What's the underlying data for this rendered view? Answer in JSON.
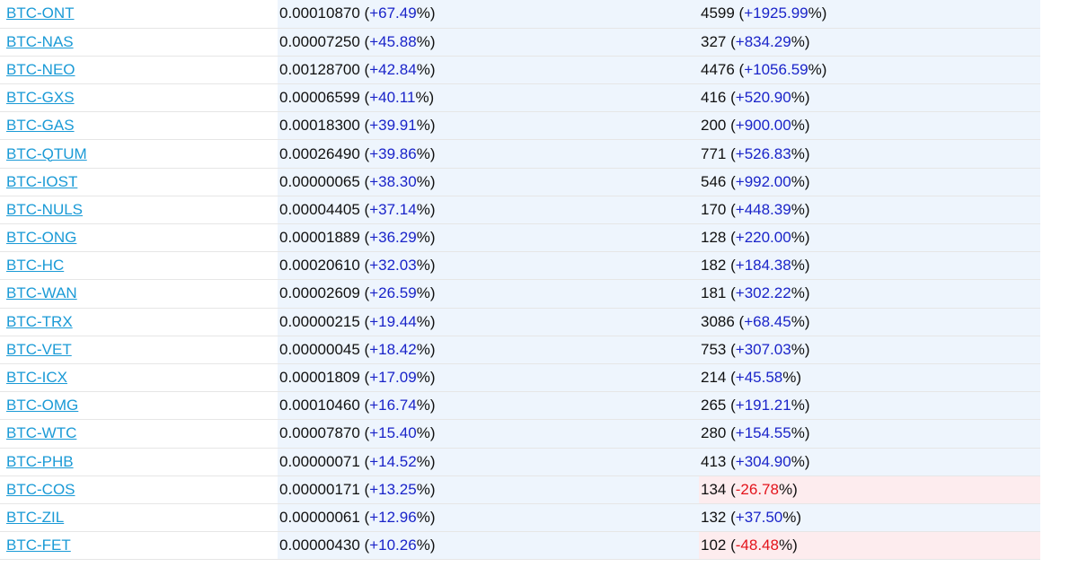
{
  "colors": {
    "link": "#1a9ad6",
    "positive": "#1a24c9",
    "negative": "#e3131b",
    "cell_bg": "#eef5fd",
    "cell_bg_negative": "#fdecee"
  },
  "rows": [
    {
      "pair": "BTC-ONT",
      "price": "0.00010870",
      "price_change": "+67.49",
      "volume": "4599",
      "volume_change": "+1925.99",
      "volume_negative": false
    },
    {
      "pair": "BTC-NAS",
      "price": "0.00007250",
      "price_change": "+45.88",
      "volume": "327",
      "volume_change": "+834.29",
      "volume_negative": false
    },
    {
      "pair": "BTC-NEO",
      "price": "0.00128700",
      "price_change": "+42.84",
      "volume": "4476",
      "volume_change": "+1056.59",
      "volume_negative": false
    },
    {
      "pair": "BTC-GXS",
      "price": "0.00006599",
      "price_change": "+40.11",
      "volume": "416",
      "volume_change": "+520.90",
      "volume_negative": false
    },
    {
      "pair": "BTC-GAS",
      "price": "0.00018300",
      "price_change": "+39.91",
      "volume": "200",
      "volume_change": "+900.00",
      "volume_negative": false
    },
    {
      "pair": "BTC-QTUM",
      "price": "0.00026490",
      "price_change": "+39.86",
      "volume": "771",
      "volume_change": "+526.83",
      "volume_negative": false
    },
    {
      "pair": "BTC-IOST",
      "price": "0.00000065",
      "price_change": "+38.30",
      "volume": "546",
      "volume_change": "+992.00",
      "volume_negative": false
    },
    {
      "pair": "BTC-NULS",
      "price": "0.00004405",
      "price_change": "+37.14",
      "volume": "170",
      "volume_change": "+448.39",
      "volume_negative": false
    },
    {
      "pair": "BTC-ONG",
      "price": "0.00001889",
      "price_change": "+36.29",
      "volume": "128",
      "volume_change": "+220.00",
      "volume_negative": false
    },
    {
      "pair": "BTC-HC",
      "price": "0.00020610",
      "price_change": "+32.03",
      "volume": "182",
      "volume_change": "+184.38",
      "volume_negative": false
    },
    {
      "pair": "BTC-WAN",
      "price": "0.00002609",
      "price_change": "+26.59",
      "volume": "181",
      "volume_change": "+302.22",
      "volume_negative": false
    },
    {
      "pair": "BTC-TRX",
      "price": "0.00000215",
      "price_change": "+19.44",
      "volume": "3086",
      "volume_change": "+68.45",
      "volume_negative": false
    },
    {
      "pair": "BTC-VET",
      "price": "0.00000045",
      "price_change": "+18.42",
      "volume": "753",
      "volume_change": "+307.03",
      "volume_negative": false
    },
    {
      "pair": "BTC-ICX",
      "price": "0.00001809",
      "price_change": "+17.09",
      "volume": "214",
      "volume_change": "+45.58",
      "volume_negative": false
    },
    {
      "pair": "BTC-OMG",
      "price": "0.00010460",
      "price_change": "+16.74",
      "volume": "265",
      "volume_change": "+191.21",
      "volume_negative": false
    },
    {
      "pair": "BTC-WTC",
      "price": "0.00007870",
      "price_change": "+15.40",
      "volume": "280",
      "volume_change": "+154.55",
      "volume_negative": false
    },
    {
      "pair": "BTC-PHB",
      "price": "0.00000071",
      "price_change": "+14.52",
      "volume": "413",
      "volume_change": "+304.90",
      "volume_negative": false
    },
    {
      "pair": "BTC-COS",
      "price": "0.00000171",
      "price_change": "+13.25",
      "volume": "134",
      "volume_change": "-26.78",
      "volume_negative": true
    },
    {
      "pair": "BTC-ZIL",
      "price": "0.00000061",
      "price_change": "+12.96",
      "volume": "132",
      "volume_change": "+37.50",
      "volume_negative": false
    },
    {
      "pair": "BTC-FET",
      "price": "0.00000430",
      "price_change": "+10.26",
      "volume": "102",
      "volume_change": "-48.48",
      "volume_negative": true
    }
  ]
}
